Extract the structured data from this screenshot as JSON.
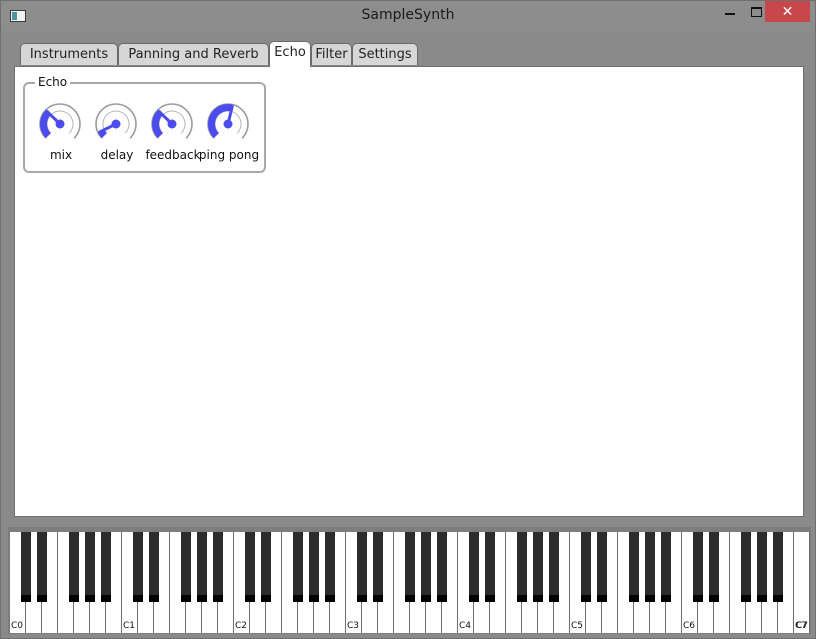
{
  "window": {
    "title": "SampleSynth",
    "close_glyph": "✕",
    "icons": [
      "app-icon",
      "minimize-icon",
      "maximize-icon",
      "close-icon"
    ]
  },
  "tabs": [
    {
      "label": "Instruments"
    },
    {
      "label": "Panning and Reverb"
    },
    {
      "label": "Echo",
      "active": true
    },
    {
      "label": "Filter"
    },
    {
      "label": "Settings"
    }
  ],
  "echo": {
    "group_title": "Echo",
    "knobs": [
      {
        "label": "mix",
        "value": 0.33
      },
      {
        "label": "delay",
        "value": 0.07
      },
      {
        "label": "feedback",
        "value": 0.33
      },
      {
        "label": "ping pong",
        "value": 0.55
      }
    ]
  },
  "piano": {
    "octave_labels": [
      "C0",
      "C1",
      "C2",
      "C3",
      "C4",
      "C5",
      "C6",
      "C7"
    ]
  },
  "colors": {
    "accent": "#4b4bf0",
    "titlebar": "#8d8d8d",
    "close": "#c8474a"
  }
}
